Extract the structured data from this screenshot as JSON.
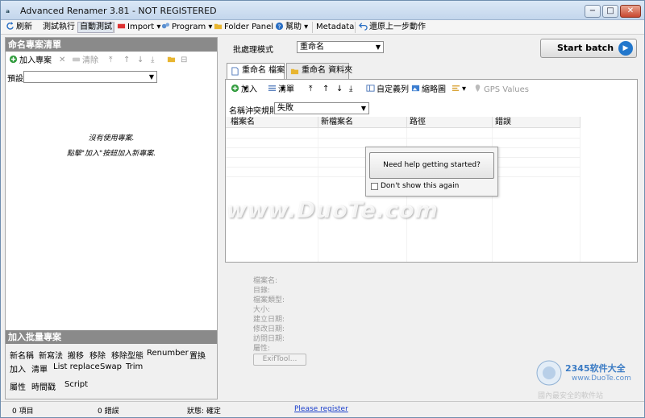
{
  "window": {
    "title": "Advanced Renamer 3.81 - NOT REGISTERED",
    "controls": [
      "−",
      "□",
      "✕"
    ]
  },
  "toolbar": {
    "refresh": "刷新",
    "test_run": "測試執行",
    "auto_test": "自動測試",
    "import": "Import",
    "program": "Program",
    "folder_panel": "Folder Panel",
    "help": "幫助",
    "metadata": "Metadata",
    "undo": "還原上一步動作"
  },
  "left_panel": {
    "header": "命名專案清單",
    "add_method": "加入專案",
    "clear": "清除",
    "preset_label": "預設:",
    "empty_line1": "沒有使用專案.",
    "empty_line2": "點擊\"加入\"按鈕加入新專案."
  },
  "batch_panel": {
    "header": "加入批量專案",
    "row1": [
      "新名稱",
      "新寫法",
      "搬移",
      "移除",
      "移除型態",
      "Renumber",
      "置換"
    ],
    "row2": [
      "加入",
      "清單",
      "List replace",
      "Swap",
      "Trim"
    ],
    "row3": [
      "屬性",
      "時間戳",
      "Script"
    ]
  },
  "mode": {
    "label": "批處理模式",
    "value": "重命名"
  },
  "start_button": "Start batch",
  "tabs": [
    {
      "label": "重命名 檔案",
      "active": true
    },
    {
      "label": "重命名 資料夾",
      "active": false
    }
  ],
  "list_toolbar": {
    "add": "加入",
    "list": "清單",
    "columns": "自定義列",
    "thumbnails": "縮略圖",
    "gps": "GPS Values"
  },
  "conflict": {
    "label": "名稱沖突規則:",
    "value": "失敗"
  },
  "columns": [
    "檔案名",
    "新檔案名",
    "路徑",
    "錯誤"
  ],
  "popup": {
    "button": "Need help getting started?",
    "checkbox": "Don't show this again"
  },
  "info_fields": [
    "檔案名:",
    "目錄:",
    "檔案類型:",
    "大小:",
    "建立日期:",
    "修改日期:",
    "訪問日期:",
    "屬性:"
  ],
  "exif_button": "ExifTool...",
  "status": {
    "items": "0 項目",
    "errors": "0 錯誤",
    "state": "狀態: 確定",
    "register": "Please register"
  },
  "watermark": "www.DuoTe.com",
  "corner_logo": {
    "brand": "2345软件大全",
    "url": "www.DuoTe.com",
    "tagline": "國內最安全的軟件站"
  },
  "colors": {
    "accent_blue": "#2277cc",
    "panel_header": "#8a8a8a",
    "link": "#1a3ecc"
  }
}
